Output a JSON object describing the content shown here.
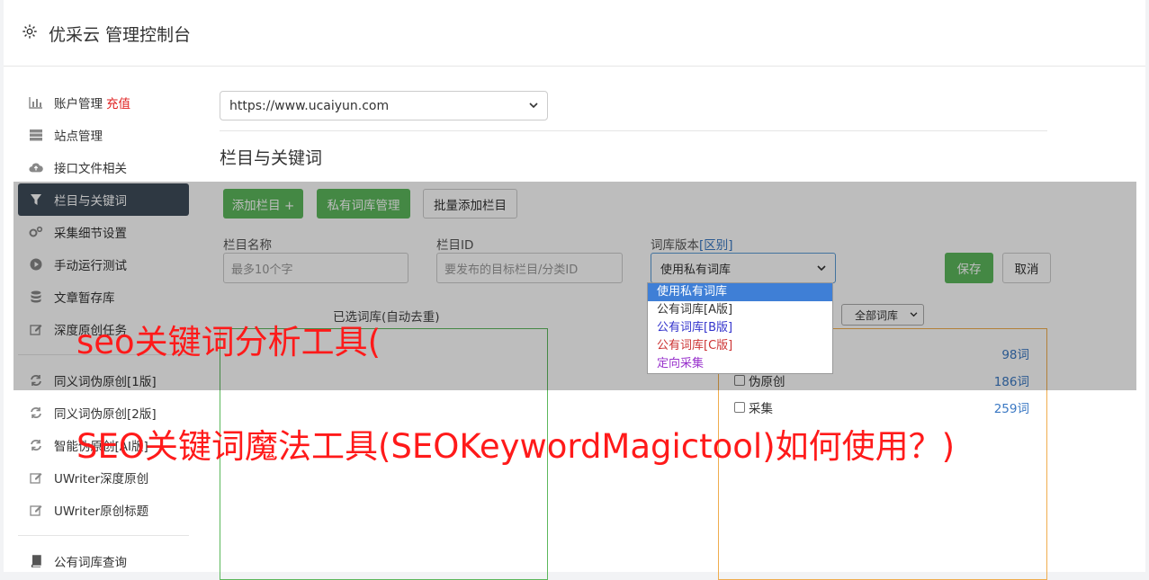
{
  "header": {
    "title": "优采云 管理控制台"
  },
  "sidebar": {
    "items": [
      {
        "label": "账户管理",
        "extra": "充值"
      },
      {
        "label": "站点管理"
      },
      {
        "label": "接口文件相关"
      },
      {
        "label": "栏目与关键词"
      },
      {
        "label": "采集细节设置"
      },
      {
        "label": "手动运行测试"
      },
      {
        "label": "文章暂存库"
      },
      {
        "label": "深度原创任务"
      },
      {
        "label": "同义词伪原创[1版]"
      },
      {
        "label": "同义词伪原创[2版]"
      },
      {
        "label": "智能伪原创[AI版]"
      },
      {
        "label": "UWriter深度原创"
      },
      {
        "label": "UWriter原创标题"
      },
      {
        "label": "公有词库查询"
      }
    ]
  },
  "site_select": {
    "value": "https://www.ucaiyun.com"
  },
  "section": {
    "title": "栏目与关键词"
  },
  "toolbar": {
    "add_label": "添加栏目 +",
    "private_lib_label": "私有词库管理",
    "batch_add_label": "批量添加栏目"
  },
  "form": {
    "name_label": "栏目名称",
    "name_placeholder": "最多10个字",
    "id_label": "栏目ID",
    "id_placeholder": "要发布的目标栏目/分类ID",
    "version_label": "词库版本",
    "version_diff": "[区别]",
    "version_value": "使用私有词库",
    "save_label": "保存",
    "cancel_label": "取消"
  },
  "version_options": [
    {
      "label": "使用私有词库",
      "color": "#ffffff"
    },
    {
      "label": "公有词库[A版]",
      "color": "#333333"
    },
    {
      "label": "公有词库[B版]",
      "color": "#3333cc"
    },
    {
      "label": "公有词库[C版]",
      "color": "#cc3333"
    },
    {
      "label": "定向采集",
      "color": "#9933cc"
    }
  ],
  "selected_words": {
    "title": "已选词库(自动去重)"
  },
  "library_filter": {
    "value": "全部词库"
  },
  "library_rows": [
    {
      "label": "",
      "count": "98词"
    },
    {
      "label": "伪原创",
      "count": "186词"
    },
    {
      "label": "采集",
      "count": "259词"
    }
  ],
  "watermark": {
    "line1": "seo关键词分析工具(",
    "line2": "SEO关键词魔法工具(SEOKeywordMagictool)如何使用？)"
  },
  "colors": {
    "accent": "#5cb85c",
    "active_nav": "#3f4c5a",
    "warn": "#f0ad4e",
    "overlay_text": "#ff1a1a"
  }
}
